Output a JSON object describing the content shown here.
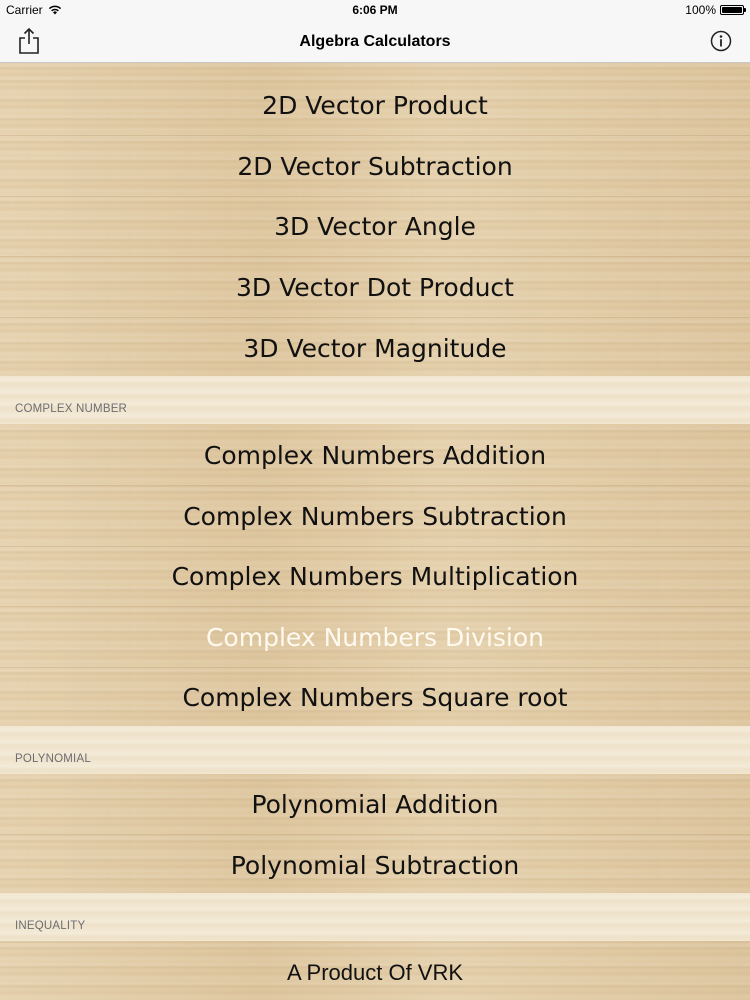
{
  "status_bar": {
    "carrier": "Carrier",
    "time": "6:06 PM",
    "battery": "100%",
    "battery_level": 1.0
  },
  "nav": {
    "title": "Algebra Calculators",
    "left_icon": "share-icon",
    "right_icon": "info-icon"
  },
  "sections": {
    "vector_items": [
      "2D Vector Product",
      "2D Vector Subtraction",
      "3D Vector Angle",
      "3D Vector Dot Product",
      "3D Vector Magnitude"
    ],
    "complex": {
      "header": "COMPLEX NUMBER",
      "items": [
        "Complex Numbers Addition",
        "Complex Numbers Subtraction",
        "Complex Numbers Multiplication",
        "Complex Numbers Division",
        "Complex Numbers Square root"
      ]
    },
    "polynomial": {
      "header": "POLYNOMIAL",
      "items": [
        "Polynomial Addition",
        "Polynomial Subtraction"
      ]
    },
    "inequality": {
      "header": "INEQUALITY"
    }
  },
  "footer": {
    "label": "A Product Of VRK"
  },
  "colors": {
    "highlight_text": "#fffaf0",
    "header_text": "#6d6d72"
  }
}
